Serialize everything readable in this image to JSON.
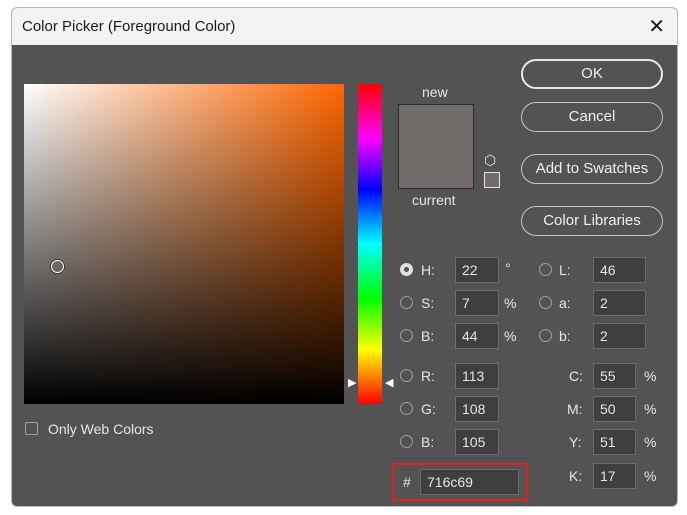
{
  "window": {
    "title": "Color Picker (Foreground Color)"
  },
  "colors": {
    "selected": "#716c69",
    "accent_highlight": "#e51d1d"
  },
  "preview": {
    "new_label": "new",
    "current_label": "current"
  },
  "buttons": {
    "ok": "OK",
    "cancel": "Cancel",
    "add_swatches": "Add to Swatches",
    "color_libraries": "Color Libraries"
  },
  "web_colors": {
    "label": "Only Web Colors",
    "checked": false
  },
  "hsb": {
    "h": {
      "label": "H:",
      "value": "22",
      "unit": "°"
    },
    "s": {
      "label": "S:",
      "value": "7",
      "unit": "%"
    },
    "b": {
      "label": "B:",
      "value": "44",
      "unit": "%"
    }
  },
  "rgb": {
    "r": {
      "label": "R:",
      "value": "113"
    },
    "g": {
      "label": "G:",
      "value": "108"
    },
    "b": {
      "label": "B:",
      "value": "105"
    }
  },
  "lab": {
    "l": {
      "label": "L:",
      "value": "46"
    },
    "a": {
      "label": "a:",
      "value": "2"
    },
    "b": {
      "label": "b:",
      "value": "2"
    }
  },
  "cmyk": {
    "c": {
      "label": "C:",
      "value": "55",
      "unit": "%"
    },
    "m": {
      "label": "M:",
      "value": "50",
      "unit": "%"
    },
    "y": {
      "label": "Y:",
      "value": "51",
      "unit": "%"
    },
    "k": {
      "label": "K:",
      "value": "17",
      "unit": "%"
    }
  },
  "hex": {
    "label": "#",
    "value": "716c69"
  }
}
